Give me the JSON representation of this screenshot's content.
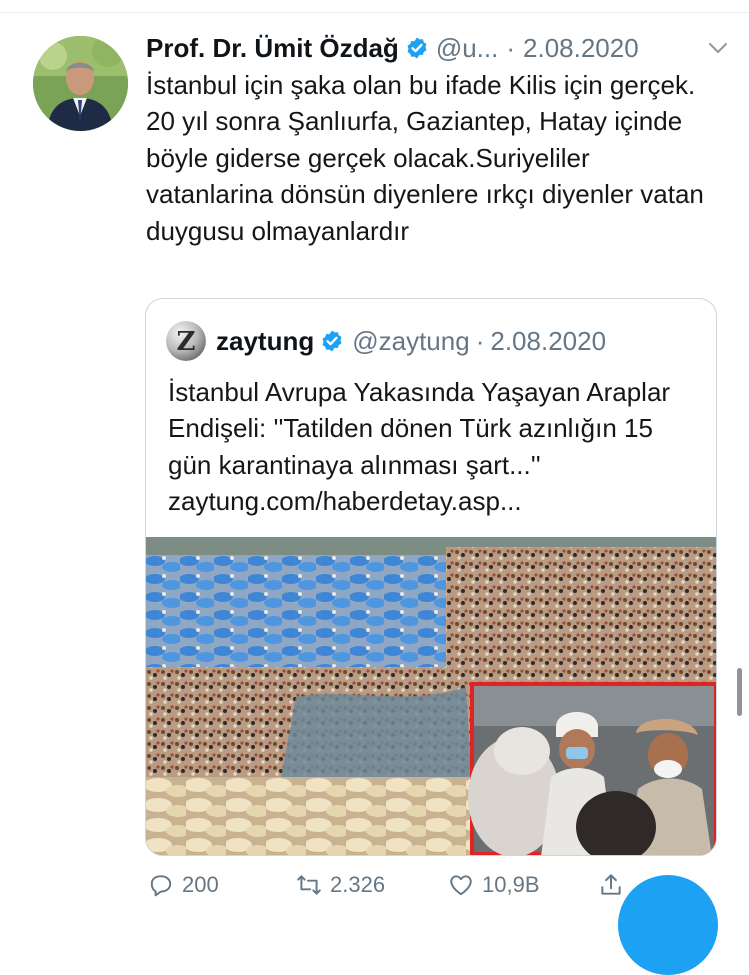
{
  "tweet": {
    "author_name": "Prof. Dr. Ümit Özdağ",
    "handle": "@u...",
    "separator": "·",
    "date": "2.08.2020",
    "text": "İstanbul için şaka olan bu ifade Kilis için gerçek. 20 yıl sonra Şanlıurfa, Gaziantep, Hatay içinde böyle giderse gerçek olacak.Suriyeliler vatanlarina dönsün diyenlere ırkçı diyenler vatan duygusu olmayanlardır"
  },
  "quote": {
    "author_name": "zaytung",
    "avatar_letter": "Z",
    "handle": "@zaytung",
    "separator": "·",
    "date": "2.08.2020",
    "text": "İstanbul Avrupa Yakasında Yaşayan Araplar Endişeli: ''Tatilden dönen Türk azınlığın 15 gün karantinaya alınması şart...'' zaytung.com/haberdetay.asp..."
  },
  "actions": {
    "reply_count": "200",
    "retweet_count": "2.326",
    "like_count": "10,9B"
  },
  "icons": {
    "verified": "verified-badge-icon",
    "chevron": "chevron-down-icon",
    "reply": "reply-icon",
    "retweet": "retweet-icon",
    "like": "heart-icon",
    "share": "share-icon"
  },
  "colors": {
    "accent": "#1da1f2",
    "secondary_text": "#657786",
    "border": "#ccd6dd"
  }
}
